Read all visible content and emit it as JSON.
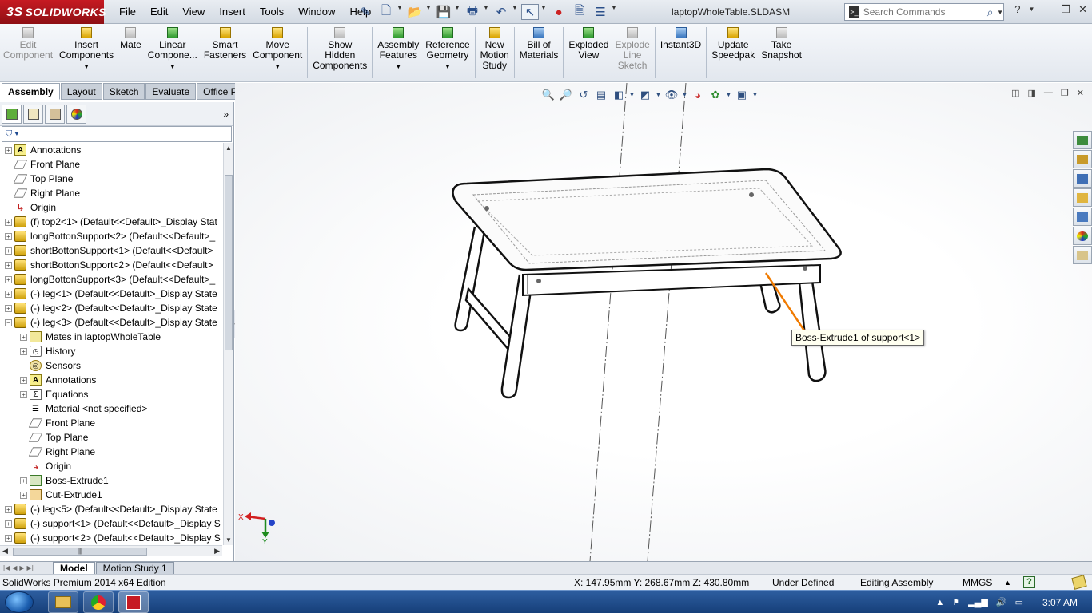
{
  "app": {
    "logo_mark": "3S",
    "logo_text": "SOLIDWORKS",
    "document_title": "laptopWholeTable.SLDASM"
  },
  "menu": [
    "File",
    "Edit",
    "View",
    "Insert",
    "Tools",
    "Window",
    "Help"
  ],
  "search": {
    "placeholder": "Search Commands"
  },
  "commands": [
    {
      "label": "Edit Component",
      "lines": [
        "Edit",
        "Component"
      ],
      "disabled": true,
      "icon": "edit-component-icon"
    },
    {
      "label": "Insert Components",
      "lines": [
        "Insert",
        "Components"
      ],
      "icon": "insert-components-icon",
      "dropdown": true
    },
    {
      "label": "Mate",
      "lines": [
        "Mate"
      ],
      "icon": "mate-icon"
    },
    {
      "label": "Linear Component Pattern",
      "lines": [
        "Linear",
        "Compone..."
      ],
      "icon": "linear-pattern-icon",
      "dropdown": true
    },
    {
      "label": "Smart Fasteners",
      "lines": [
        "Smart",
        "Fasteners"
      ],
      "icon": "smart-fasteners-icon"
    },
    {
      "label": "Move Component",
      "lines": [
        "Move",
        "Component"
      ],
      "icon": "move-component-icon",
      "dropdown": true
    },
    {
      "label": "Show Hidden Components",
      "lines": [
        "Show",
        "Hidden",
        "Components"
      ],
      "icon": "show-hidden-icon"
    },
    {
      "label": "Assembly Features",
      "lines": [
        "Assembly",
        "Features"
      ],
      "icon": "assembly-features-icon",
      "dropdown": true
    },
    {
      "label": "Reference Geometry",
      "lines": [
        "Reference",
        "Geometry"
      ],
      "icon": "reference-geometry-icon",
      "dropdown": true
    },
    {
      "label": "New Motion Study",
      "lines": [
        "New",
        "Motion",
        "Study"
      ],
      "icon": "motion-study-icon"
    },
    {
      "label": "Bill of Materials",
      "lines": [
        "Bill of",
        "Materials"
      ],
      "icon": "bill-of-materials-icon"
    },
    {
      "label": "Exploded View",
      "lines": [
        "Exploded",
        "View"
      ],
      "icon": "exploded-view-icon"
    },
    {
      "label": "Explode Line Sketch",
      "lines": [
        "Explode",
        "Line",
        "Sketch"
      ],
      "disabled": true,
      "icon": "explode-line-icon"
    },
    {
      "label": "Instant3D",
      "lines": [
        "Instant3D"
      ],
      "icon": "instant3d-icon"
    },
    {
      "label": "Update Speedpak",
      "lines": [
        "Update",
        "Speedpak"
      ],
      "icon": "speedpak-icon"
    },
    {
      "label": "Take Snapshot",
      "lines": [
        "Take",
        "Snapshot"
      ],
      "icon": "snapshot-icon"
    }
  ],
  "tabs": [
    "Assembly",
    "Layout",
    "Sketch",
    "Evaluate",
    "Office Products"
  ],
  "active_tab": "Assembly",
  "tree": [
    {
      "indent": 0,
      "expander": "+",
      "icon": "ann",
      "label": "Annotations"
    },
    {
      "indent": 0,
      "expander": "",
      "icon": "plane",
      "label": "Front Plane"
    },
    {
      "indent": 0,
      "expander": "",
      "icon": "plane",
      "label": "Top Plane"
    },
    {
      "indent": 0,
      "expander": "",
      "icon": "plane",
      "label": "Right Plane"
    },
    {
      "indent": 0,
      "expander": "",
      "icon": "orig",
      "label": "Origin"
    },
    {
      "indent": 0,
      "expander": "+",
      "icon": "part",
      "label": "(f) top2<1> (Default<<Default>_Display Stat"
    },
    {
      "indent": 0,
      "expander": "+",
      "icon": "part",
      "label": "longBottonSupport<2> (Default<<Default>_"
    },
    {
      "indent": 0,
      "expander": "+",
      "icon": "part",
      "label": "shortBottonSupport<1> (Default<<Default>"
    },
    {
      "indent": 0,
      "expander": "+",
      "icon": "part",
      "label": "shortBottonSupport<2> (Default<<Default>"
    },
    {
      "indent": 0,
      "expander": "+",
      "icon": "part",
      "label": "longBottonSupport<3> (Default<<Default>_"
    },
    {
      "indent": 0,
      "expander": "+",
      "icon": "part",
      "label": "(-) leg<1> (Default<<Default>_Display State"
    },
    {
      "indent": 0,
      "expander": "+",
      "icon": "part",
      "label": "(-) leg<2> (Default<<Default>_Display State"
    },
    {
      "indent": 0,
      "expander": "−",
      "icon": "part",
      "label": "(-) leg<3> (Default<<Default>_Display State"
    },
    {
      "indent": 1,
      "expander": "+",
      "icon": "mate",
      "label": "Mates in laptopWholeTable"
    },
    {
      "indent": 1,
      "expander": "+",
      "icon": "hist",
      "label": "History"
    },
    {
      "indent": 1,
      "expander": "",
      "icon": "sens",
      "label": "Sensors"
    },
    {
      "indent": 1,
      "expander": "+",
      "icon": "ann",
      "label": "Annotations"
    },
    {
      "indent": 1,
      "expander": "+",
      "icon": "eq",
      "label": "Equations"
    },
    {
      "indent": 1,
      "expander": "",
      "icon": "mat",
      "label": "Material <not specified>"
    },
    {
      "indent": 1,
      "expander": "",
      "icon": "plane",
      "label": "Front Plane"
    },
    {
      "indent": 1,
      "expander": "",
      "icon": "plane",
      "label": "Top Plane"
    },
    {
      "indent": 1,
      "expander": "",
      "icon": "plane",
      "label": "Right Plane"
    },
    {
      "indent": 1,
      "expander": "",
      "icon": "orig",
      "label": "Origin"
    },
    {
      "indent": 1,
      "expander": "+",
      "icon": "boss",
      "label": "Boss-Extrude1"
    },
    {
      "indent": 1,
      "expander": "+",
      "icon": "cut",
      "label": "Cut-Extrude1"
    },
    {
      "indent": 0,
      "expander": "+",
      "icon": "part",
      "label": "(-) leg<5> (Default<<Default>_Display State"
    },
    {
      "indent": 0,
      "expander": "+",
      "icon": "part",
      "label": "(-) support<1> (Default<<Default>_Display S"
    },
    {
      "indent": 0,
      "expander": "+",
      "icon": "part",
      "label": "(-) support<2> (Default<<Default>_Display S"
    }
  ],
  "tooltip": "Boss-Extrude1 of support<1>",
  "triad": {
    "x_label": "X",
    "y_label": "Y"
  },
  "bottom_tabs": [
    "Model",
    "Motion Study 1"
  ],
  "status": {
    "edition": "SolidWorks Premium 2014 x64 Edition",
    "coords": "X: 147.95mm Y: 268.67mm Z: 430.80mm",
    "definition": "Under Defined",
    "mode": "Editing Assembly",
    "units": "MMGS",
    "units_arrow": "▲",
    "help": "?"
  },
  "taskbar": {
    "clock": "3:07 AM"
  },
  "colors": {
    "logo_red": "#c61a22",
    "highlight_edge": "#f07a00",
    "title_bar": "#d3dae3"
  }
}
